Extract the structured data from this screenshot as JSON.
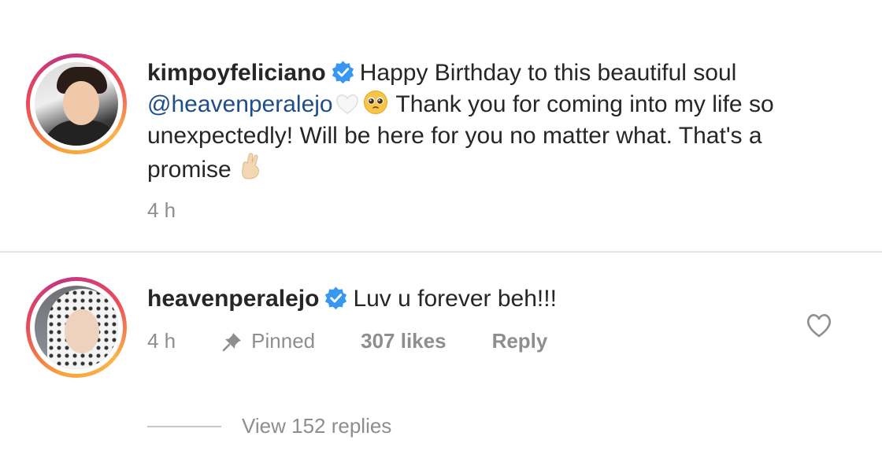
{
  "comments": [
    {
      "username": "kimpoyfeliciano",
      "verified": true,
      "text_part1": "Happy Birthday to this beautiful soul ",
      "mention": "@heavenperalejo",
      "text_part2": " Thank you for coming into my life so unexpectedly! Will be here for you no matter what. That's a promise",
      "emojis": [
        "white-heart",
        "pleading-face",
        "crossed-fingers"
      ],
      "time": "4 h"
    },
    {
      "username": "heavenperalejo",
      "verified": true,
      "text": "Luv u forever beh!!!",
      "time": "4 h",
      "pinned_label": "Pinned",
      "likes": "307 likes",
      "reply_label": "Reply"
    }
  ],
  "view_replies": "View 152 replies",
  "colors": {
    "text": "#262626",
    "muted": "#8e8e8e",
    "mention": "#1f4e87",
    "verified": "#3897f0"
  }
}
